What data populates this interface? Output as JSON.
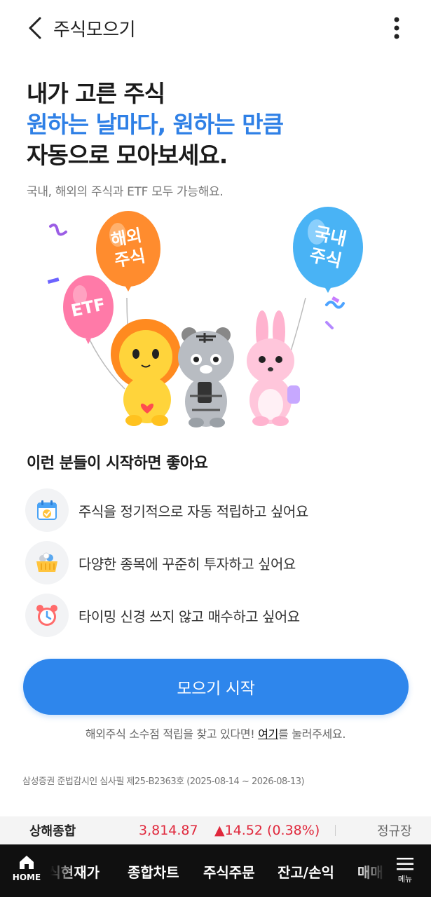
{
  "header": {
    "title": "주식모으기",
    "back_icon": "chevron-left-icon",
    "more_icon": "more-vertical-icon"
  },
  "hero": {
    "line1": "내가 고른 주식",
    "line2": "원하는 날마다, 원하는 만큼",
    "line3": "자동으로 모아보세요.",
    "subtitle": "국내, 해외의 주식과 ETF 모두 가능해요.",
    "accent_color": "#2f80e6"
  },
  "illustration": {
    "balloons": {
      "etf": "ETF",
      "overseas": [
        "해외",
        "주식"
      ],
      "domestic": [
        "국내",
        "주식"
      ]
    },
    "characters": [
      "lion-character",
      "tiger-character",
      "rabbit-character"
    ]
  },
  "benefits": {
    "title": "이런 분들이 시작하면 좋아요",
    "items": [
      {
        "icon": "calendar-check-icon",
        "text": "주식을 정기적으로 자동 적립하고 싶어요"
      },
      {
        "icon": "basket-icon",
        "text": "다양한 종목에 꾸준히 투자하고 싶어요"
      },
      {
        "icon": "alarm-clock-icon",
        "text": "타이밍 신경 쓰지 않고 매수하고 싶어요"
      }
    ]
  },
  "cta": {
    "start_label": "모으기 시작",
    "button_color": "#2e86ec"
  },
  "overseas_note": {
    "prefix": "해외주식 소수점 적립을 찾고 있다면! ",
    "link": "여기",
    "suffix": "를 눌러주세요."
  },
  "legal": "삼성증권 준법감시인 심사필 제25-B2363호 (2025-08-14 ~ 2026-08-13)",
  "ticker": {
    "name": "상해종합",
    "price": "3,814.87",
    "change": "▲14.52 (0.38%)",
    "status": "정규장",
    "up_color": "#e0283c"
  },
  "bottom_nav": {
    "home_label": "HOME",
    "items": [
      "주식현재가",
      "종합차트",
      "주식주문",
      "잔고/손익",
      "매매"
    ],
    "menu_label": "메뉴"
  }
}
